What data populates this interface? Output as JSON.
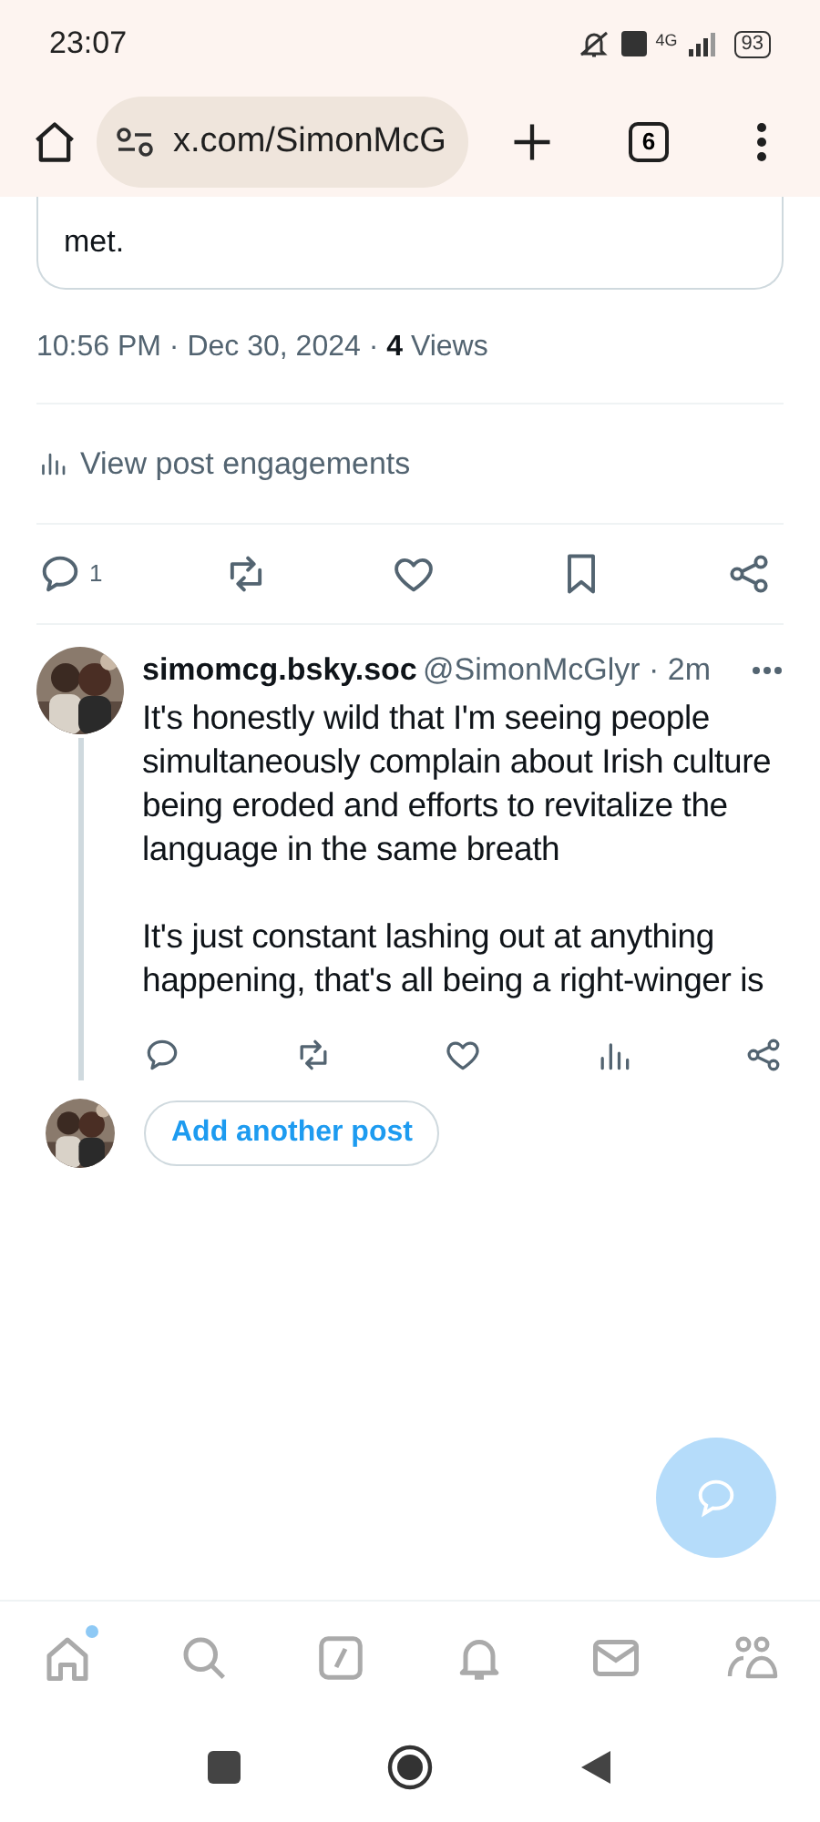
{
  "status_bar": {
    "time": "23:07",
    "battery": "93",
    "network": "4G"
  },
  "browser": {
    "url": "x.com/SimonMcG",
    "tab_count": "6"
  },
  "quoted_post": {
    "text_tail": "met."
  },
  "post_meta": {
    "time": "10:56 PM · Dec 30, 2024 · ",
    "views_count": "4",
    "views_label": " Views"
  },
  "engagements_link": "View post engagements",
  "actions": [
    {
      "kind": "reply",
      "count": "1"
    },
    {
      "kind": "repost"
    },
    {
      "kind": "like"
    },
    {
      "kind": "bookmark"
    },
    {
      "kind": "share"
    }
  ],
  "reply": {
    "display_name": "simomcg.bsky.soc",
    "handle": "@SimonMcGlyr",
    "age": "· 2m",
    "paragraphs": [
      "It's honestly wild that I'm seeing people simultaneously complain about Irish culture being eroded and efforts to revitalize the language in the same breath",
      "It's just constant lashing out at anything happening, that's all being a right-winger is"
    ],
    "actions": [
      {
        "kind": "reply"
      },
      {
        "kind": "repost"
      },
      {
        "kind": "like"
      },
      {
        "kind": "views"
      },
      {
        "kind": "share"
      }
    ]
  },
  "add_post_button": "Add another post",
  "bottom_nav": [
    {
      "kind": "home",
      "unread": true
    },
    {
      "kind": "search",
      "unread": false
    },
    {
      "kind": "grok",
      "unread": false
    },
    {
      "kind": "notifications",
      "unread": false
    },
    {
      "kind": "messages",
      "unread": false
    },
    {
      "kind": "communities",
      "unread": false
    }
  ]
}
